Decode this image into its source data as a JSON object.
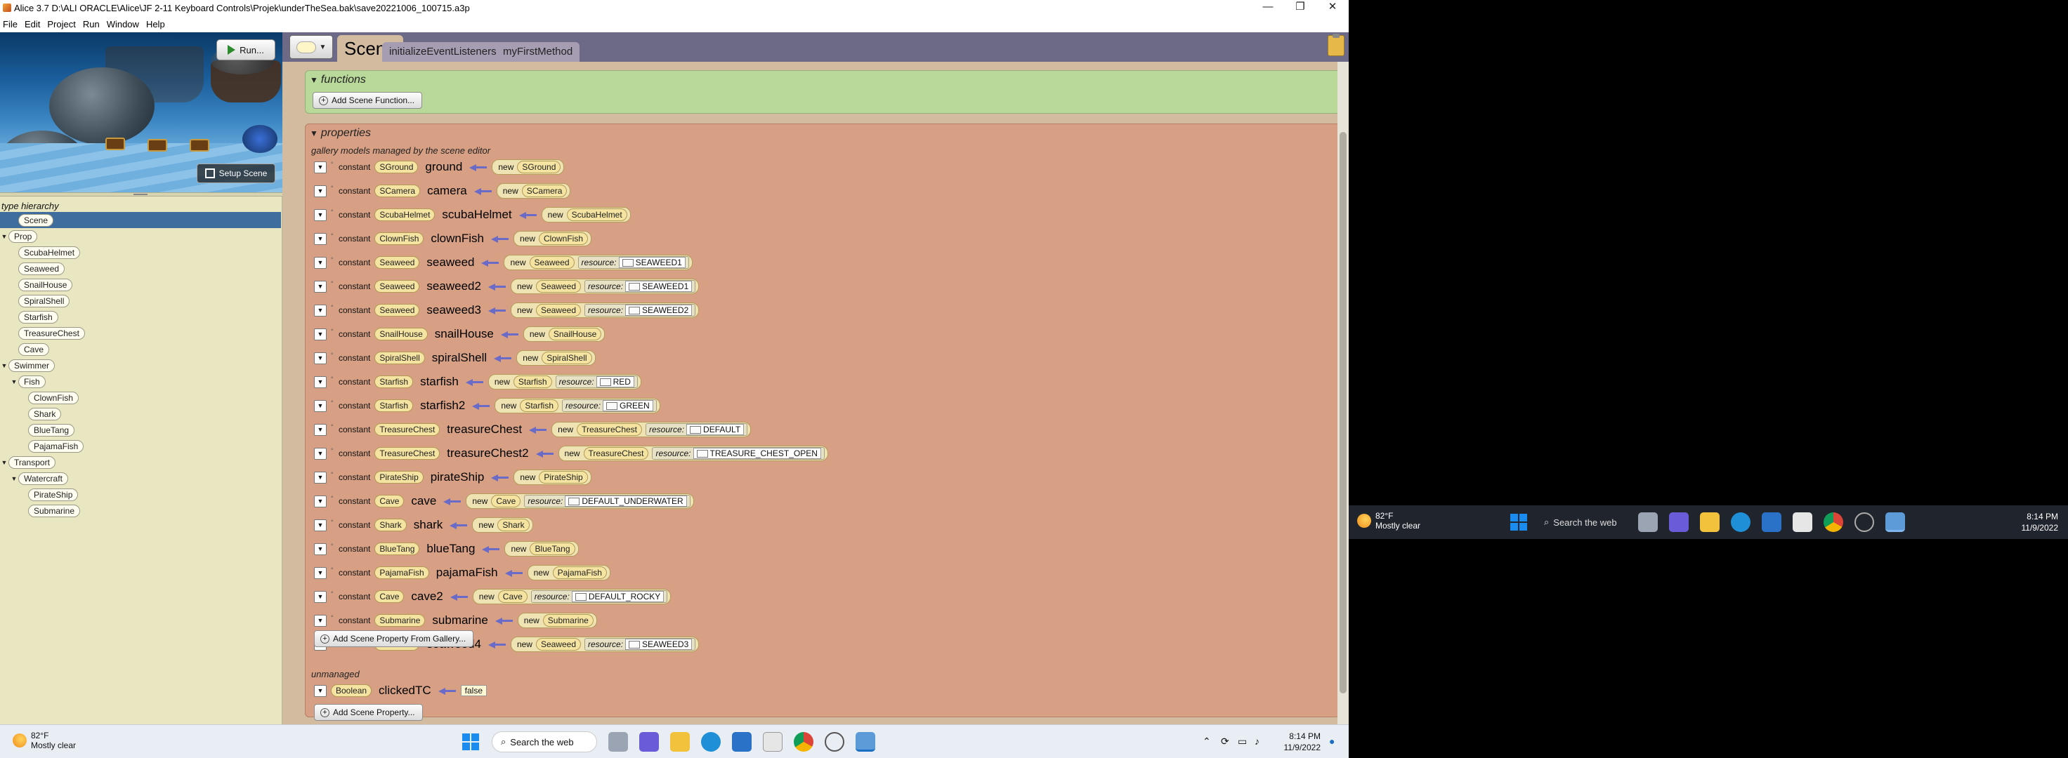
{
  "window": {
    "title": "Alice 3.7 D:\\ALI ORACLE\\Alice\\JF 2-11 Keyboard Controls\\Projek\\underTheSea.bak\\save20221006_100715.a3p",
    "minimize": "—",
    "maximize": "❐",
    "close": "✕"
  },
  "menu": [
    "File",
    "Edit",
    "Project",
    "Run",
    "Window",
    "Help"
  ],
  "preview": {
    "run_label": "Run...",
    "setup_label": "Setup Scene"
  },
  "type_hierarchy": {
    "title": "type hierarchy",
    "items": [
      {
        "label": "Scene",
        "level": 0,
        "expander": "",
        "selected": true
      },
      {
        "label": "Prop",
        "level": 0,
        "expander": "▼"
      },
      {
        "label": "ScubaHelmet",
        "level": 1,
        "expander": ""
      },
      {
        "label": "Seaweed",
        "level": 1,
        "expander": ""
      },
      {
        "label": "SnailHouse",
        "level": 1,
        "expander": ""
      },
      {
        "label": "SpiralShell",
        "level": 1,
        "expander": ""
      },
      {
        "label": "Starfish",
        "level": 1,
        "expander": ""
      },
      {
        "label": "TreasureChest",
        "level": 1,
        "expander": ""
      },
      {
        "label": "Cave",
        "level": 1,
        "expander": ""
      },
      {
        "label": "Swimmer",
        "level": 0,
        "expander": "▼"
      },
      {
        "label": "Fish",
        "level": 1,
        "expander": "▼"
      },
      {
        "label": "ClownFish",
        "level": 2,
        "expander": ""
      },
      {
        "label": "Shark",
        "level": 2,
        "expander": ""
      },
      {
        "label": "BlueTang",
        "level": 2,
        "expander": ""
      },
      {
        "label": "PajamaFish",
        "level": 2,
        "expander": ""
      },
      {
        "label": "Transport",
        "level": 0,
        "expander": "▼"
      },
      {
        "label": "Watercraft",
        "level": 1,
        "expander": "▼"
      },
      {
        "label": "PirateShip",
        "level": 2,
        "expander": ""
      },
      {
        "label": "Submarine",
        "level": 2,
        "expander": ""
      }
    ]
  },
  "tabs": {
    "scene": "Scene",
    "others": [
      "initializeEventListeners",
      "myFirstMethod"
    ]
  },
  "functions_panel": {
    "title": "functions",
    "add_label": "Add Scene Function..."
  },
  "properties_panel": {
    "title": "properties",
    "managed_label": "gallery models managed by the scene editor",
    "constant_kw": "constant",
    "new_kw": "new",
    "resource_kw": "resource:",
    "rows": [
      {
        "type": "SGround",
        "name": "ground",
        "ctor": "SGround",
        "resource": ""
      },
      {
        "type": "SCamera",
        "name": "camera",
        "ctor": "SCamera",
        "resource": ""
      },
      {
        "type": "ScubaHelmet",
        "name": "scubaHelmet",
        "ctor": "ScubaHelmet",
        "resource": ""
      },
      {
        "type": "ClownFish",
        "name": "clownFish",
        "ctor": "ClownFish",
        "resource": ""
      },
      {
        "type": "Seaweed",
        "name": "seaweed",
        "ctor": "Seaweed",
        "resource": "SEAWEED1"
      },
      {
        "type": "Seaweed",
        "name": "seaweed2",
        "ctor": "Seaweed",
        "resource": "SEAWEED1"
      },
      {
        "type": "Seaweed",
        "name": "seaweed3",
        "ctor": "Seaweed",
        "resource": "SEAWEED2"
      },
      {
        "type": "SnailHouse",
        "name": "snailHouse",
        "ctor": "SnailHouse",
        "resource": ""
      },
      {
        "type": "SpiralShell",
        "name": "spiralShell",
        "ctor": "SpiralShell",
        "resource": ""
      },
      {
        "type": "Starfish",
        "name": "starfish",
        "ctor": "Starfish",
        "resource": "RED"
      },
      {
        "type": "Starfish",
        "name": "starfish2",
        "ctor": "Starfish",
        "resource": "GREEN"
      },
      {
        "type": "TreasureChest",
        "name": "treasureChest",
        "ctor": "TreasureChest",
        "resource": "DEFAULT"
      },
      {
        "type": "TreasureChest",
        "name": "treasureChest2",
        "ctor": "TreasureChest",
        "resource": "TREASURE_CHEST_OPEN"
      },
      {
        "type": "PirateShip",
        "name": "pirateShip",
        "ctor": "PirateShip",
        "resource": ""
      },
      {
        "type": "Cave",
        "name": "cave",
        "ctor": "Cave",
        "resource": "DEFAULT_UNDERWATER"
      },
      {
        "type": "Shark",
        "name": "shark",
        "ctor": "Shark",
        "resource": ""
      },
      {
        "type": "BlueTang",
        "name": "blueTang",
        "ctor": "BlueTang",
        "resource": ""
      },
      {
        "type": "PajamaFish",
        "name": "pajamaFish",
        "ctor": "PajamaFish",
        "resource": ""
      },
      {
        "type": "Cave",
        "name": "cave2",
        "ctor": "Cave",
        "resource": "DEFAULT_ROCKY"
      },
      {
        "type": "Submarine",
        "name": "submarine",
        "ctor": "Submarine",
        "resource": ""
      },
      {
        "type": "Seaweed",
        "name": "seaweed4",
        "ctor": "Seaweed",
        "resource": "SEAWEED3"
      }
    ],
    "add_from_gallery": "Add Scene Property From Gallery...",
    "unmanaged_label": "unmanaged",
    "unmanaged_row": {
      "type": "Boolean",
      "name": "clickedTC",
      "value": "false"
    },
    "add_property": "Add Scene Property..."
  },
  "taskbar_main": {
    "temp": "82°F",
    "condition": "Mostly clear",
    "search": "Search the web",
    "time": "8:14 PM",
    "date": "11/9/2022"
  },
  "taskbar_second": {
    "temp": "82°F",
    "condition": "Mostly clear",
    "search": "Search the web",
    "time": "8:14 PM",
    "date": "11/9/2022"
  },
  "colors": {
    "tabstrip": "#6d6a87",
    "editor_bg": "#d3bba0",
    "functions_bg": "#b8d99a",
    "properties_bg": "#d7a084",
    "selection": "#3f6d9e"
  }
}
